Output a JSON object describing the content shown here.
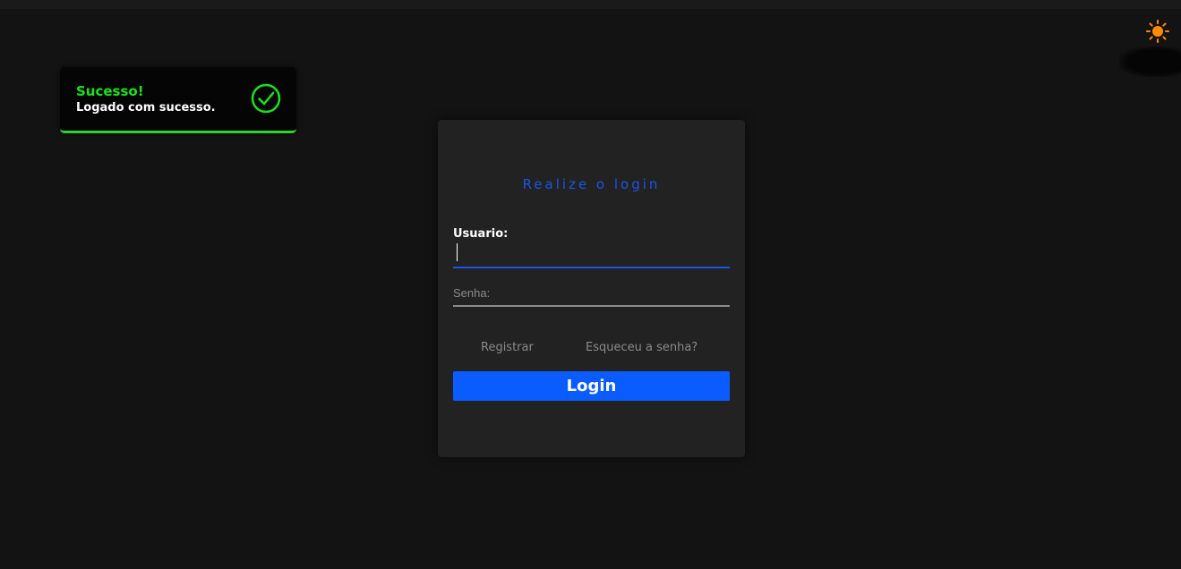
{
  "toast": {
    "title": "Sucesso!",
    "message": "Logado com sucesso.",
    "icon": "check-circle-icon",
    "accent_color": "#2ad62a"
  },
  "theme_toggle": {
    "icon": "sun-icon",
    "color": "#ff8c00"
  },
  "login_form": {
    "title": "Realize o login",
    "username_label": "Usuario:",
    "username_value": "",
    "password_placeholder": "Senha:",
    "register_link": "Registrar",
    "forgot_link": "Esqueceu a senha?",
    "submit_label": "Login",
    "accent_color": "#0a5cff"
  }
}
